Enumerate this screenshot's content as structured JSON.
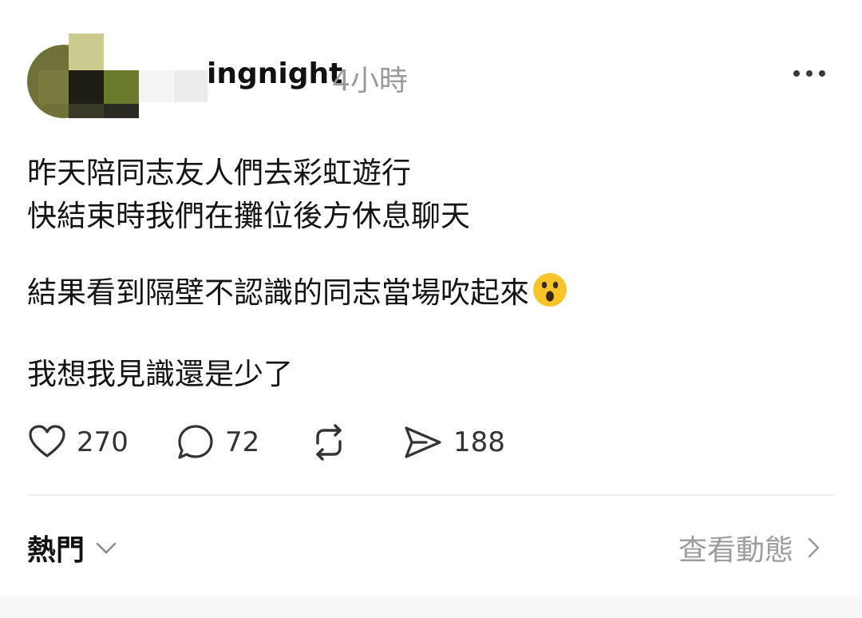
{
  "header": {
    "username": "ingnight",
    "timestamp": "4小時",
    "more_icon": "ellipsis-icon"
  },
  "post": {
    "lines": [
      "昨天陪同志友人們去彩虹遊行",
      "快結束時我們在攤位後方休息聊天",
      "結果看到隔壁不認識的同志當場吹起來",
      "我想我見識還是少了"
    ],
    "emoji": "surprised-face-emoji"
  },
  "actions": {
    "like": {
      "icon": "heart-icon",
      "count": "270"
    },
    "comment": {
      "icon": "comment-bubble-icon",
      "count": "72"
    },
    "repost": {
      "icon": "repost-icon",
      "count": ""
    },
    "share": {
      "icon": "send-icon",
      "count": "188"
    }
  },
  "footer": {
    "sort_label": "熱門",
    "view_activity_label": "查看動態"
  },
  "colors": {
    "text_primary": "#111111",
    "text_secondary": "#9a9a9a",
    "divider": "#efefef",
    "emoji_yellow": "#f7c42a"
  }
}
